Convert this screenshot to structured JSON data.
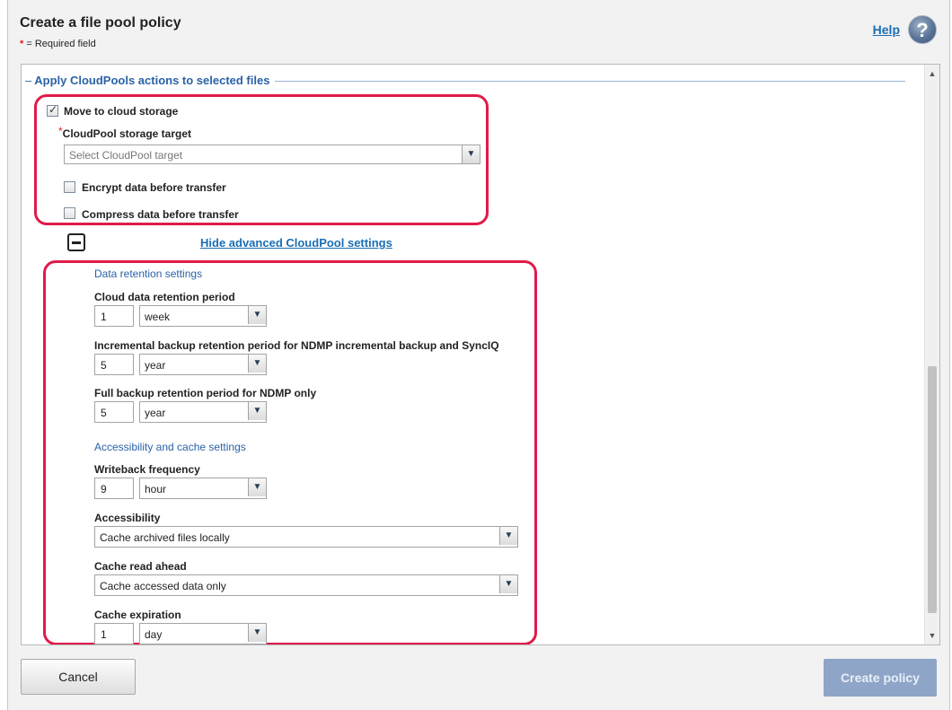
{
  "header": {
    "title": "Create a file pool policy",
    "required_star": "*",
    "required_note": " = Required field",
    "help_label": "Help",
    "help_icon_glyph": "?"
  },
  "cloudpools": {
    "legend": "Apply CloudPools actions to selected files",
    "legend_dash": "–",
    "move_label": "Move to cloud storage",
    "move_checked": true,
    "target_star": "*",
    "target_label": "CloudPool storage target",
    "target_placeholder": "Select CloudPool target",
    "encrypt_label": "Encrypt data before transfer",
    "encrypt_checked": false,
    "compress_label": "Compress data before transfer",
    "compress_checked": false,
    "advanced_link": "Hide advanced CloudPool settings"
  },
  "retention": {
    "heading": "Data retention settings",
    "cloud_label": "Cloud data retention period",
    "cloud_value": "1",
    "cloud_unit": "week",
    "incremental_label": "Incremental backup retention period for NDMP incremental backup and SyncIQ",
    "incremental_value": "5",
    "incremental_unit": "year",
    "full_label": "Full backup retention period for NDMP only",
    "full_value": "5",
    "full_unit": "year"
  },
  "cache": {
    "heading": "Accessibility and cache settings",
    "writeback_label": "Writeback frequency",
    "writeback_value": "9",
    "writeback_unit": "hour",
    "accessibility_label": "Accessibility",
    "accessibility_value": "Cache archived files locally",
    "read_ahead_label": "Cache read ahead",
    "read_ahead_value": "Cache accessed data only",
    "expiration_label": "Cache expiration",
    "expiration_value": "1",
    "expiration_unit": "day"
  },
  "footer": {
    "cancel_label": "Cancel",
    "create_label": "Create policy"
  },
  "icons": {
    "dropdown": "chevron-down-icon",
    "scroll_up": "arrow-up-icon",
    "scroll_down": "arrow-down-icon",
    "collapse": "minus-icon",
    "help": "question-mark-icon"
  },
  "colors": {
    "highlight": "#e01b49",
    "link": "#1a6eb5",
    "section": "#2a62a8",
    "create_button": "#8fa5c8"
  }
}
